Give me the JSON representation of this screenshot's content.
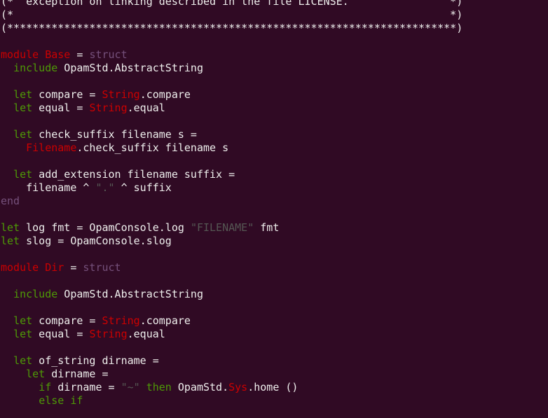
{
  "colors": {
    "background": "#300a24",
    "default": "#eeeeec",
    "keyword": "#4e9a06",
    "keyword2": "#75507b",
    "module": "#cc0000",
    "string": "#555753",
    "comment": "#eeeeec"
  },
  "lines": [
    [
      [
        "comment",
        "(*  exception on linking described in the file LICENSE.                *)"
      ]
    ],
    [
      [
        "comment",
        "(*                                                                     *)"
      ]
    ],
    [
      [
        "comment",
        "(***********************************************************************)"
      ]
    ],
    [],
    [
      [
        "module",
        "module Base"
      ],
      [
        "default",
        " = "
      ],
      [
        "keyword2",
        "struct"
      ]
    ],
    [
      [
        "default",
        "  "
      ],
      [
        "keyword",
        "include"
      ],
      [
        "default",
        " OpamStd.AbstractString"
      ]
    ],
    [],
    [
      [
        "default",
        "  "
      ],
      [
        "keyword",
        "let"
      ],
      [
        "default",
        " compare = "
      ],
      [
        "module",
        "String"
      ],
      [
        "default",
        ".compare"
      ]
    ],
    [
      [
        "default",
        "  "
      ],
      [
        "keyword",
        "let"
      ],
      [
        "default",
        " equal = "
      ],
      [
        "module",
        "String"
      ],
      [
        "default",
        ".equal"
      ]
    ],
    [],
    [
      [
        "default",
        "  "
      ],
      [
        "keyword",
        "let"
      ],
      [
        "default",
        " check_suffix filename s ="
      ]
    ],
    [
      [
        "default",
        "    "
      ],
      [
        "module",
        "Filename"
      ],
      [
        "default",
        ".check_suffix filename s"
      ]
    ],
    [],
    [
      [
        "default",
        "  "
      ],
      [
        "keyword",
        "let"
      ],
      [
        "default",
        " add_extension filename suffix ="
      ]
    ],
    [
      [
        "default",
        "    filename ^ "
      ],
      [
        "string",
        "\".\""
      ],
      [
        "default",
        " ^ suffix"
      ]
    ],
    [
      [
        "keyword2",
        "end"
      ]
    ],
    [],
    [
      [
        "keyword",
        "let"
      ],
      [
        "default",
        " log fmt = OpamConsole.log "
      ],
      [
        "string",
        "\"FILENAME\""
      ],
      [
        "default",
        " fmt"
      ]
    ],
    [
      [
        "keyword",
        "let"
      ],
      [
        "default",
        " slog = OpamConsole.slog"
      ]
    ],
    [],
    [
      [
        "module",
        "module Dir"
      ],
      [
        "default",
        " = "
      ],
      [
        "keyword2",
        "struct"
      ]
    ],
    [],
    [
      [
        "default",
        "  "
      ],
      [
        "keyword",
        "include"
      ],
      [
        "default",
        " OpamStd.AbstractString"
      ]
    ],
    [],
    [
      [
        "default",
        "  "
      ],
      [
        "keyword",
        "let"
      ],
      [
        "default",
        " compare = "
      ],
      [
        "module",
        "String"
      ],
      [
        "default",
        ".compare"
      ]
    ],
    [
      [
        "default",
        "  "
      ],
      [
        "keyword",
        "let"
      ],
      [
        "default",
        " equal = "
      ],
      [
        "module",
        "String"
      ],
      [
        "default",
        ".equal"
      ]
    ],
    [],
    [
      [
        "default",
        "  "
      ],
      [
        "keyword",
        "let"
      ],
      [
        "default",
        " of_string dirname ="
      ]
    ],
    [
      [
        "default",
        "    "
      ],
      [
        "keyword",
        "let"
      ],
      [
        "default",
        " dirname ="
      ]
    ],
    [
      [
        "default",
        "      "
      ],
      [
        "keyword",
        "if"
      ],
      [
        "default",
        " dirname = "
      ],
      [
        "string",
        "\"~\""
      ],
      [
        "default",
        " "
      ],
      [
        "keyword",
        "then"
      ],
      [
        "default",
        " OpamStd."
      ],
      [
        "module",
        "Sys"
      ],
      [
        "default",
        ".home ()"
      ]
    ],
    [
      [
        "default",
        "      "
      ],
      [
        "keyword",
        "else if"
      ]
    ]
  ]
}
